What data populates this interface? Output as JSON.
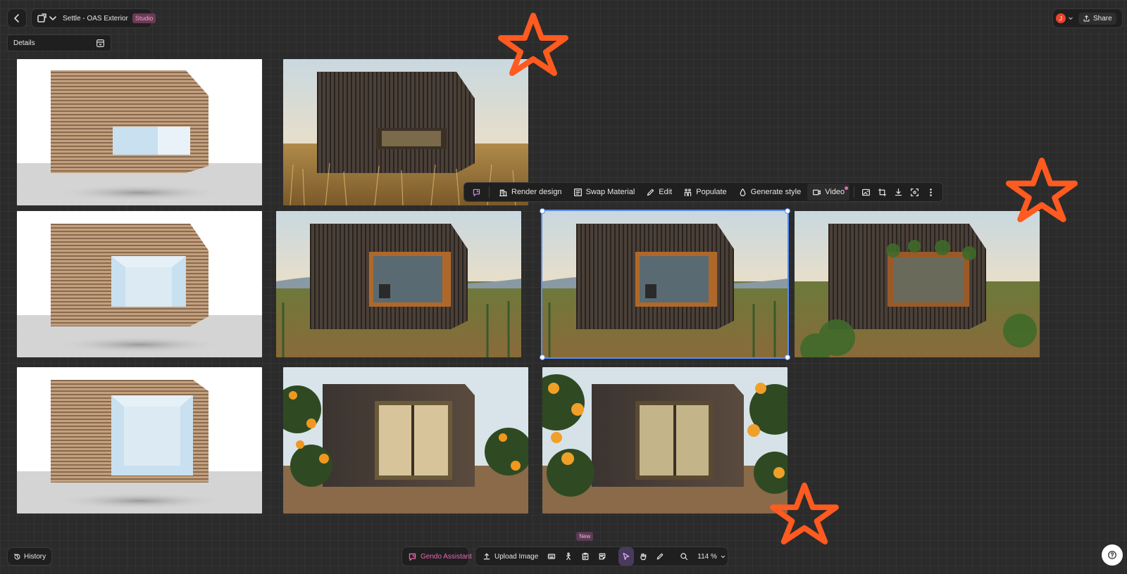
{
  "header": {
    "project_title": "Settle - OAS Exterior",
    "plan_badge": "Studio",
    "avatar_initial": "J",
    "share_label": "Share"
  },
  "details_panel": {
    "label": "Details"
  },
  "floating_toolbar": {
    "render_design": "Render design",
    "swap_material": "Swap Material",
    "edit": "Edit",
    "populate": "Populate",
    "generate_style": "Generate style",
    "video": "Video"
  },
  "bottom_bar": {
    "history": "History",
    "assistant": "Gendo Assistant",
    "upload_image": "Upload Image",
    "new_badge": "New",
    "zoom": "114 %"
  },
  "colors": {
    "accent": "#5b8def",
    "annotation": "#ff5a1f",
    "assistant": "#e46ab0",
    "avatar": "#e8452c"
  }
}
